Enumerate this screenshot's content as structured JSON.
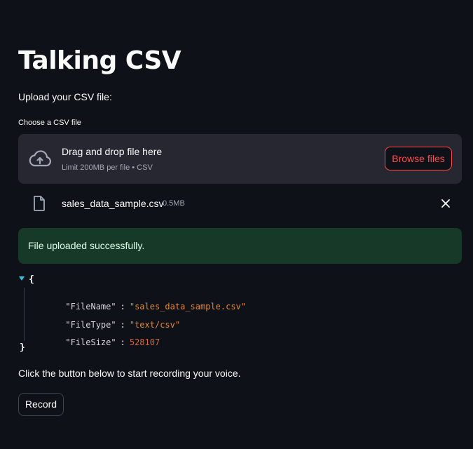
{
  "page": {
    "title": "Talking CSV",
    "intro": "Upload your CSV file:"
  },
  "uploader": {
    "label": "Choose a CSV file",
    "drop_title": "Drag and drop file here",
    "limit_text": "Limit 200MB per file • CSV",
    "browse_label": "Browse files",
    "icon": "cloud-upload-icon"
  },
  "uploaded_file": {
    "name": "sales_data_sample.csv",
    "size": "0.5MB",
    "icon": "file-icon",
    "remove_icon": "close-icon"
  },
  "status": {
    "message": "File uploaded successfully."
  },
  "json_view": {
    "open_brace": "{",
    "close_brace": "}",
    "entries": [
      {
        "key": "\"FileName\"",
        "value": "\"sales_data_sample.csv\"",
        "type": "string"
      },
      {
        "key": "\"FileType\"",
        "value": "\"text/csv\"",
        "type": "string"
      },
      {
        "key": "\"FileSize\"",
        "value": "528107",
        "type": "number"
      }
    ]
  },
  "recording": {
    "hint": "Click the button below to start recording your voice.",
    "button_label": "Record"
  },
  "colors": {
    "background": "#0e1117",
    "accent": "#ff4b4b",
    "success_bg": "#173928",
    "dropzone_bg": "#262730"
  }
}
